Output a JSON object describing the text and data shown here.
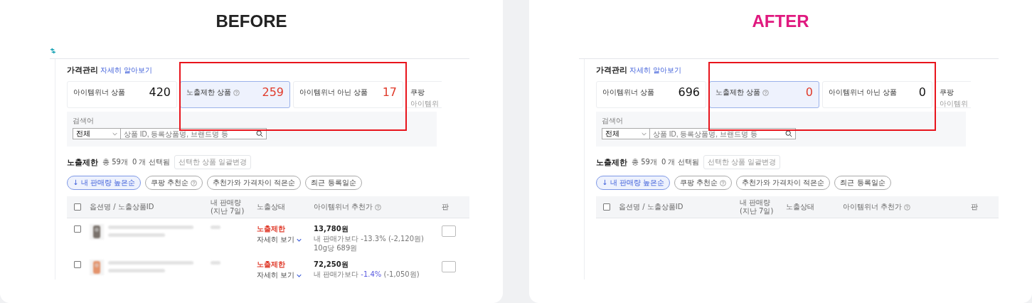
{
  "panels": [
    {
      "label": "BEFORE",
      "color": "#222222",
      "show_logo": true,
      "all_checked": false,
      "heading": "가격관리",
      "heading_link": "자세히 알아보기",
      "cards": [
        {
          "kind": "stat",
          "label": "아이템위너 상품",
          "value": "420",
          "help": false,
          "alert": false,
          "selected": false
        },
        {
          "kind": "stat",
          "label": "노출제한 상품",
          "value": "259",
          "help": true,
          "alert": true,
          "selected": true
        },
        {
          "kind": "stat",
          "label": "아이템위너 아닌 상품",
          "value": "17",
          "help": false,
          "alert": true,
          "selected": false
        },
        {
          "kind": "cut",
          "label": "쿠팡",
          "sub": "아이템위"
        }
      ],
      "search": {
        "label": "검색어",
        "select": "전체",
        "placeholder": "상품 ID, 등록상품명, 브랜드명 등"
      },
      "section": {
        "title": "노출제한",
        "total": "총 59개",
        "selected_count": "0 개 선택됨",
        "bulk_button": "선택한 상품 일괄변경"
      },
      "sorts": [
        {
          "label": "↓ 내 판매량 높은순",
          "help": false,
          "selected": true
        },
        {
          "label": "쿠팡 추천순",
          "help": true,
          "selected": false
        },
        {
          "label": "추천가와 가격차이 적은순",
          "help": false,
          "selected": false
        },
        {
          "label": "최근 등록일순",
          "help": false,
          "selected": false
        }
      ],
      "columns": [
        {
          "label": "옵션명 / 노출상품ID",
          "help": false
        },
        {
          "label": "내 판매량",
          "sub": "(지난 7일)",
          "help": false
        },
        {
          "label": "노출상태",
          "help": false
        },
        {
          "label": "아이템위너 추천가",
          "help": true
        },
        {
          "label": "판",
          "help": false
        }
      ],
      "rows": [
        {
          "checked": false,
          "status": "노출제한",
          "detail": "자세히 보기",
          "price": "13,780원",
          "compare": "내 판매가보다",
          "diff": "-13.3%",
          "diff_highlight": false,
          "diff_amount": "(-2,120원)",
          "unit": "10g당 689원"
        },
        {
          "checked": false,
          "status": "노출제한",
          "detail": "자세히 보기",
          "price": "72,250원",
          "compare": "내 판매가보다",
          "diff": "-1.4%",
          "diff_highlight": true,
          "diff_amount": "(-1,050원)"
        }
      ]
    },
    {
      "label": "AFTER",
      "color": "#e0197f",
      "show_logo": false,
      "all_checked": false,
      "heading": "가격관리",
      "heading_link": "자세히 알아보기",
      "cards": [
        {
          "kind": "stat",
          "label": "아이템위너 상품",
          "value": "696",
          "help": false,
          "alert": false,
          "selected": false
        },
        {
          "kind": "stat",
          "label": "노출제한 상품",
          "value": "0",
          "help": true,
          "alert": true,
          "selected": true
        },
        {
          "kind": "stat",
          "label": "아이템위너 아닌 상품",
          "value": "0",
          "help": false,
          "alert": false,
          "selected": false
        },
        {
          "kind": "cut",
          "label": "쿠팡",
          "sub": "아이템위"
        }
      ],
      "search": {
        "label": "검색어",
        "select": "전체",
        "placeholder": "상품 ID, 등록상품명, 브랜드명 등"
      },
      "section": {
        "title": "노출제한",
        "total": "총 59개",
        "selected_count": "0 개 선택됨",
        "bulk_button": "선택한 상품 일괄변경"
      },
      "sorts": [
        {
          "label": "↓ 내 판매량 높은순",
          "help": false,
          "selected": true
        },
        {
          "label": "쿠팡 추천순",
          "help": true,
          "selected": false
        },
        {
          "label": "추천가와 가격차이 적은순",
          "help": false,
          "selected": false
        },
        {
          "label": "최근 등록일순",
          "help": false,
          "selected": false
        }
      ],
      "columns": [
        {
          "label": "옵션명 / 노출상품ID",
          "help": false
        },
        {
          "label": "내 판매량",
          "sub": "(지난 7일)",
          "help": false
        },
        {
          "label": "노출상태",
          "help": false
        },
        {
          "label": "아이템위너 추천가",
          "help": true
        },
        {
          "label": "판",
          "help": false
        }
      ]
    }
  ]
}
